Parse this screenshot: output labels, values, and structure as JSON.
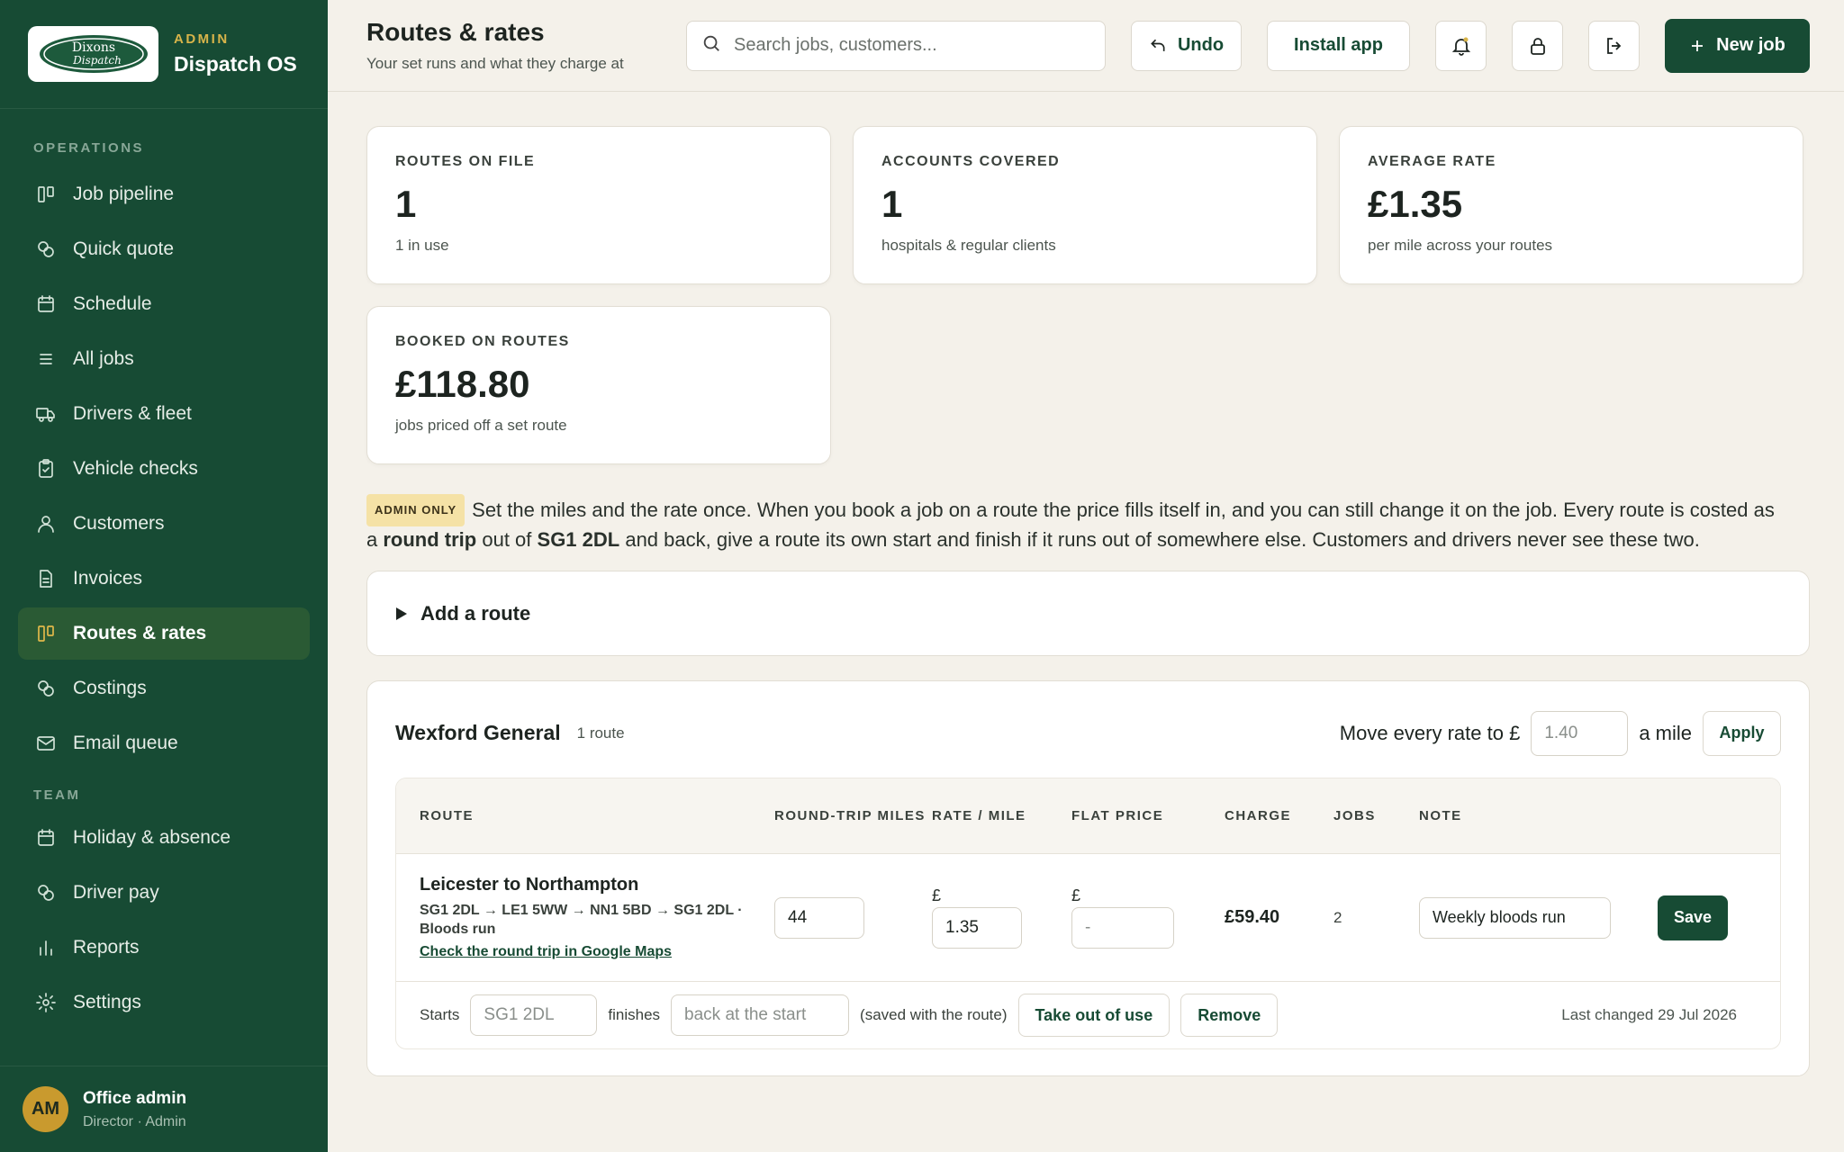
{
  "brand": {
    "logo_text_1": "Dixons",
    "logo_text_2": "Dispatch",
    "kicker": "ADMIN",
    "title": "Dispatch OS"
  },
  "nav": {
    "operations_label": "OPERATIONS",
    "team_label": "TEAM",
    "operations": [
      {
        "label": "Job pipeline",
        "icon": "pipeline-icon"
      },
      {
        "label": "Quick quote",
        "icon": "coins-icon"
      },
      {
        "label": "Schedule",
        "icon": "calendar-icon"
      },
      {
        "label": "All jobs",
        "icon": "list-icon"
      },
      {
        "label": "Drivers & fleet",
        "icon": "truck-icon"
      },
      {
        "label": "Vehicle checks",
        "icon": "clipboard-check-icon"
      },
      {
        "label": "Customers",
        "icon": "user-icon"
      },
      {
        "label": "Invoices",
        "icon": "file-icon"
      },
      {
        "label": "Routes & rates",
        "icon": "pipeline-icon",
        "active": true
      },
      {
        "label": "Costings",
        "icon": "coins-icon"
      },
      {
        "label": "Email queue",
        "icon": "mail-icon"
      }
    ],
    "team": [
      {
        "label": "Holiday & absence",
        "icon": "calendar-icon"
      },
      {
        "label": "Driver pay",
        "icon": "coins-icon"
      },
      {
        "label": "Reports",
        "icon": "bar-chart-icon"
      },
      {
        "label": "Settings",
        "icon": "gear-icon"
      }
    ]
  },
  "user": {
    "initials": "AM",
    "name": "Office admin",
    "role": "Director · Admin"
  },
  "header": {
    "title": "Routes & rates",
    "subtitle": "Your set runs and what they charge at",
    "search_placeholder": "Search jobs, customers...",
    "undo_label": "Undo",
    "install_label": "Install app",
    "new_job_label": "New job"
  },
  "stats": [
    {
      "label": "ROUTES ON FILE",
      "value": "1",
      "note": "1 in use"
    },
    {
      "label": "ACCOUNTS COVERED",
      "value": "1",
      "note": "hospitals & regular clients"
    },
    {
      "label": "AVERAGE RATE",
      "value": "£1.35",
      "note": "per mile across your routes"
    },
    {
      "label": "BOOKED ON ROUTES",
      "value": "£118.80",
      "note": "jobs priced off a set route"
    }
  ],
  "intro": {
    "badge": "ADMIN ONLY",
    "text_1": "Set the miles and the rate once. When you book a job on a route the price fills itself in, and you can still change it on the job. Every route is costed as a ",
    "bold_1": "round trip",
    "text_2": " out of ",
    "bold_2": "SG1 2DL",
    "text_3": " and back, give a route its own start and finish if it runs out of somewhere else. Customers and drivers never see these two."
  },
  "add_route_label": "Add a route",
  "group": {
    "name": "Wexford General",
    "count": "1 route",
    "bulk_prefix": "Move every rate to £",
    "bulk_placeholder": "1.40",
    "bulk_suffix": "a mile",
    "apply_label": "Apply",
    "columns": {
      "route": "ROUTE",
      "miles": "ROUND-TRIP MILES",
      "rate": "RATE / MILE",
      "flat": "FLAT PRICE",
      "charge": "CHARGE",
      "jobs": "JOBS",
      "note": "NOTE"
    },
    "row": {
      "name": "Leicester to Northampton",
      "path": "SG1 2DL → LE1 5WW → NN1 5BD → SG1 2DL · Bloods run",
      "maps_link": "Check the round trip in Google Maps",
      "miles": "44",
      "currency": "£",
      "rate": "1.35",
      "flat_placeholder": "-",
      "charge": "£59.40",
      "jobs": "2",
      "note": "Weekly bloods run",
      "save_label": "Save"
    },
    "footer": {
      "starts_label": "Starts",
      "starts_placeholder": "SG1 2DL",
      "finishes_label": "finishes",
      "finishes_placeholder": "back at the start",
      "saved_note": "(saved with the route)",
      "take_out_label": "Take out of use",
      "remove_label": "Remove",
      "last_changed": "Last changed 29 Jul 2026"
    }
  },
  "colors": {
    "sidebar": "#174b34",
    "accent_gold": "#d8b44a",
    "background": "#f4f1ea",
    "primary": "#174b34"
  }
}
